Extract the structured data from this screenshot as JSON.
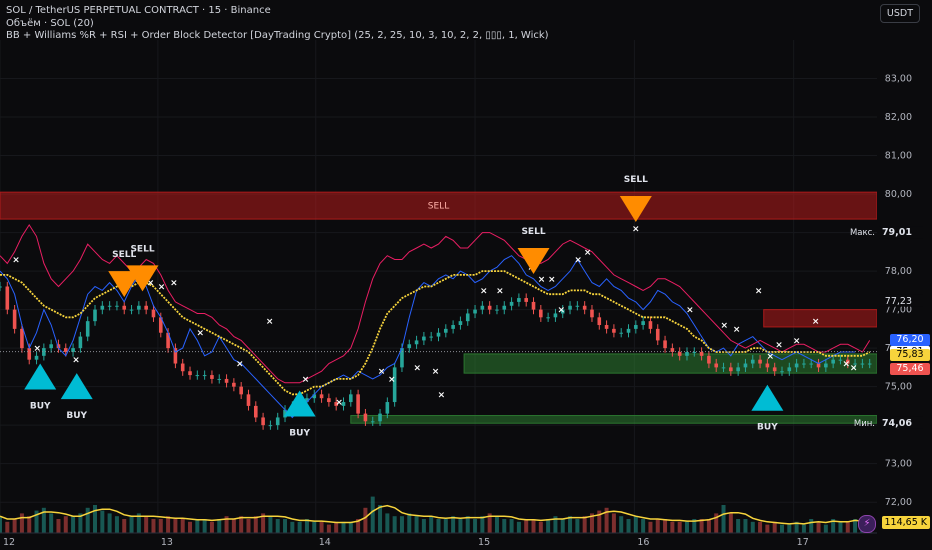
{
  "header": {
    "title": "SOL / TetherUS PERPETUAL CONTRACT · 15 · Binance",
    "volume_label": "Объём · SOL (20)",
    "indicator": "BB + Williams %R + RSI + Order Block Detector [DayTrading Crypto] (25, 2, 25, 10, 3, 10, 2, 2, ▯▯▯, 1, Wick)"
  },
  "currency_button": "USDT",
  "colors": {
    "up": "#26a69a",
    "down": "#ef5350",
    "bb_upper": "#2962ff",
    "bb_lower": "#e91e63",
    "basis": "#f7d43c",
    "buy": "#00bcd4",
    "sell": "#ff8c00",
    "supply_zone": "#b71c1c",
    "demand_zone": "#2e7d32"
  },
  "chart_data": {
    "type": "line",
    "title": "SOL / TetherUS PERPETUAL CONTRACT · 15 · Binance",
    "y_ticks": [
      "83,00",
      "82,00",
      "81,00",
      "80,00",
      "79,01",
      "78,00",
      "77,23",
      "77,00",
      "76,20",
      "75,91",
      "75,83",
      "75,46",
      "75,00",
      "74,06",
      "73,00",
      "72,00"
    ],
    "y_ticks_plain": [
      83,
      82,
      81,
      80,
      79,
      78,
      77,
      76,
      75,
      74,
      73,
      72
    ],
    "x_labels": [
      "12",
      "13",
      "14",
      "15",
      "16",
      "17"
    ],
    "ylim": [
      71.2,
      84.0
    ],
    "x_range": [
      0,
      120
    ],
    "x_label_positions": [
      0,
      21.6,
      43.2,
      65,
      86.8,
      108.6
    ],
    "price_labels": [
      {
        "label": "76,20",
        "value": 76.2,
        "bg": "#2962ff",
        "fg": "#ffffff"
      },
      {
        "label": "75,91",
        "value": 75.91,
        "bg": "#ffffff",
        "fg": "#000000"
      },
      {
        "label": "75,83",
        "value": 75.83,
        "bg": "#f7d43c",
        "fg": "#000000"
      },
      {
        "label": "75,46",
        "value": 75.46,
        "bg": "#ef5350",
        "fg": "#ffffff"
      }
    ],
    "max_label": "Макс.",
    "max_value": 79.01,
    "max_text": "79,01",
    "min_label": "Мин.",
    "min_value": 74.06,
    "min_text": "74,06",
    "current_price_line": 75.91,
    "volume_value": "114,65 K",
    "series": [
      {
        "values": [
          78.0,
          77.8,
          77.4,
          76.6,
          76.0,
          76.4,
          77.0,
          76.6,
          76.0,
          75.8,
          76.2,
          76.8,
          77.4,
          77.6,
          77.5,
          77.7,
          77.5,
          77.2,
          77.6,
          77.9,
          77.6,
          77.1,
          76.8,
          76.4,
          75.9,
          76.0,
          76.5,
          76.2,
          75.8,
          75.9,
          76.3,
          76.0,
          75.7,
          75.6,
          75.4,
          75.2,
          75.0,
          74.8,
          74.6,
          74.4,
          74.2,
          74.4,
          74.6,
          74.8,
          75.0,
          75.1,
          75.2,
          75.3,
          75.2,
          75.4,
          75.3,
          75.2,
          75.3,
          75.5,
          75.6,
          76.0,
          76.8,
          77.5,
          77.7,
          77.6,
          77.8,
          77.9,
          77.8,
          78.0,
          77.9,
          77.7,
          77.8,
          78.0,
          78.1,
          78.3,
          78.4,
          78.2,
          77.9,
          77.8,
          77.6,
          77.5,
          77.6,
          77.8,
          78.0,
          78.3,
          78.0,
          77.7,
          77.6,
          77.8,
          77.6,
          77.5,
          77.3,
          77.2,
          77.0,
          77.2,
          77.5,
          77.4,
          77.2,
          77.1,
          76.9,
          76.6,
          76.3,
          76.0,
          75.9,
          76.0,
          75.8,
          76.1,
          76.2,
          76.3,
          76.1,
          75.9,
          75.8,
          75.7,
          75.8,
          75.9,
          75.8,
          75.7,
          75.6,
          75.7,
          75.8,
          75.9,
          75.9,
          75.9
        ]
      },
      {
        "values": [
          78.4,
          78.2,
          78.5,
          78.9,
          79.2,
          78.9,
          78.2,
          77.8,
          77.6,
          77.8,
          78.0,
          78.3,
          78.7,
          78.5,
          78.3,
          78.2,
          78.4,
          78.2,
          78.0,
          78.1,
          78.3,
          78.2,
          77.9,
          77.5,
          77.2,
          77.1,
          77.0,
          76.9,
          76.9,
          76.8,
          76.6,
          76.5,
          76.3,
          76.2,
          76.0,
          75.8,
          75.6,
          75.4,
          75.2,
          75.1,
          75.1,
          75.1,
          75.2,
          75.3,
          75.4,
          75.6,
          75.7,
          75.8,
          76.0,
          76.5,
          77.2,
          77.8,
          78.2,
          78.4,
          78.3,
          78.3,
          78.5,
          78.6,
          78.7,
          78.6,
          78.7,
          78.9,
          78.8,
          78.6,
          78.6,
          78.8,
          79.0,
          79.0,
          78.9,
          78.8,
          78.6,
          78.4,
          78.3,
          78.3,
          78.2,
          78.3,
          78.5,
          78.7,
          78.8,
          78.7,
          78.6,
          78.5,
          78.3,
          78.1,
          77.9,
          77.8,
          77.7,
          77.6,
          77.5,
          77.6,
          77.8,
          77.8,
          77.7,
          77.6,
          77.4,
          77.2,
          77.0,
          76.8,
          76.6,
          76.4,
          76.2,
          76.1,
          76.0,
          76.1,
          76.2,
          76.1,
          76.0,
          75.9,
          76.0,
          76.1,
          76.1,
          76.0,
          75.9,
          75.9,
          76.0,
          76.1,
          76.1,
          76.0,
          75.9,
          76.2
        ]
      },
      {
        "values": [
          77.9,
          77.9,
          77.8,
          77.7,
          77.5,
          77.3,
          77.1,
          77.0,
          76.9,
          76.8,
          76.8,
          76.9,
          77.1,
          77.3,
          77.4,
          77.5,
          77.6,
          77.6,
          77.6,
          77.7,
          77.7,
          77.6,
          77.4,
          77.2,
          77.0,
          76.8,
          76.7,
          76.6,
          76.5,
          76.4,
          76.3,
          76.2,
          76.1,
          76.0,
          75.9,
          75.7,
          75.5,
          75.3,
          75.1,
          74.9,
          74.8,
          74.8,
          74.9,
          75.0,
          75.0,
          75.1,
          75.2,
          75.2,
          75.2,
          75.3,
          75.6,
          76.0,
          76.5,
          76.9,
          77.1,
          77.3,
          77.4,
          77.5,
          77.6,
          77.6,
          77.7,
          77.8,
          77.9,
          77.9,
          77.9,
          77.9,
          78.0,
          78.0,
          78.0,
          78.0,
          77.9,
          77.8,
          77.7,
          77.6,
          77.5,
          77.4,
          77.4,
          77.4,
          77.5,
          77.5,
          77.5,
          77.4,
          77.4,
          77.3,
          77.2,
          77.1,
          77.0,
          76.9,
          76.8,
          76.8,
          76.8,
          76.8,
          76.7,
          76.6,
          76.5,
          76.3,
          76.2,
          76.0,
          75.9,
          75.9,
          75.9,
          75.9,
          75.9,
          76.0,
          76.0,
          75.9,
          75.9,
          75.9,
          75.9,
          75.9,
          75.9,
          75.9,
          75.9,
          75.8,
          75.8,
          75.8,
          75.8,
          75.8,
          75.8,
          75.9
        ]
      },
      {
        "values": [
          77.6,
          77.0,
          76.5,
          76.0,
          75.7,
          75.8,
          76.0,
          76.1,
          76.0,
          75.9,
          76.0,
          76.3,
          76.7,
          77.0,
          77.1,
          77.1,
          77.1,
          77.0,
          77.0,
          77.1,
          77.0,
          76.8,
          76.4,
          76.0,
          75.6,
          75.4,
          75.3,
          75.3,
          75.3,
          75.2,
          75.2,
          75.1,
          75.0,
          74.8,
          74.5,
          74.2,
          74.0,
          74.0,
          74.2,
          74.4,
          74.5,
          74.6,
          74.7,
          74.8,
          74.7,
          74.6,
          74.5,
          74.6,
          74.8,
          74.3,
          74.1,
          74.1,
          74.3,
          74.6,
          75.5,
          76.0,
          76.1,
          76.2,
          76.3,
          76.3,
          76.4,
          76.5,
          76.6,
          76.7,
          76.9,
          77.0,
          77.1,
          77.0,
          77.0,
          77.1,
          77.2,
          77.3,
          77.2,
          77.0,
          76.8,
          76.8,
          76.9,
          77.0,
          77.1,
          77.1,
          77.0,
          76.8,
          76.6,
          76.5,
          76.4,
          76.4,
          76.5,
          76.6,
          76.7,
          76.5,
          76.2,
          76.0,
          75.9,
          75.8,
          75.9,
          75.9,
          75.8,
          75.6,
          75.5,
          75.5,
          75.4,
          75.5,
          75.6,
          75.7,
          75.6,
          75.5,
          75.4,
          75.4,
          75.5,
          75.6,
          75.6,
          75.6,
          75.5,
          75.6,
          75.7,
          75.7,
          75.6,
          75.6,
          75.6,
          75.6
        ]
      },
      {
        "values": [
          0.6,
          0.4,
          0.5,
          0.7,
          0.6,
          0.8,
          0.9,
          0.7,
          0.5,
          0.6,
          0.6,
          0.7,
          0.9,
          1.0,
          0.8,
          0.7,
          0.6,
          0.5,
          0.6,
          0.7,
          0.6,
          0.5,
          0.5,
          0.6,
          0.5,
          0.5,
          0.4,
          0.5,
          0.5,
          0.4,
          0.5,
          0.6,
          0.5,
          0.6,
          0.5,
          0.6,
          0.7,
          0.6,
          0.5,
          0.5,
          0.4,
          0.4,
          0.5,
          0.4,
          0.4,
          0.3,
          0.4,
          0.4,
          0.4,
          0.5,
          0.9,
          1.3,
          1.0,
          0.7,
          0.6,
          0.6,
          0.7,
          0.6,
          0.5,
          0.6,
          0.5,
          0.5,
          0.6,
          0.5,
          0.6,
          0.5,
          0.6,
          0.7,
          0.6,
          0.5,
          0.5,
          0.4,
          0.5,
          0.5,
          0.4,
          0.5,
          0.6,
          0.5,
          0.6,
          0.5,
          0.6,
          0.7,
          0.8,
          0.9,
          0.7,
          0.6,
          0.5,
          0.6,
          0.5,
          0.4,
          0.5,
          0.5,
          0.4,
          0.4,
          0.4,
          0.5,
          0.5,
          0.5,
          0.7,
          1.0,
          0.7,
          0.5,
          0.5,
          0.4,
          0.4,
          0.3,
          0.4,
          0.3,
          0.3,
          0.4,
          0.3,
          0.5,
          0.4,
          0.3,
          0.5,
          0.4,
          0.4,
          0.5,
          0.4,
          0.3
        ]
      }
    ],
    "zones": [
      {
        "label": "SELL",
        "kind": "supply",
        "x0": 0,
        "x1": 120,
        "y0": 79.35,
        "y1": 80.05
      },
      {
        "label": "",
        "kind": "supply",
        "x0": 104.5,
        "x1": 120,
        "y0": 76.55,
        "y1": 77.0
      },
      {
        "label": "",
        "kind": "demand",
        "x0": 63.5,
        "x1": 120,
        "y0": 75.35,
        "y1": 75.85
      },
      {
        "label": "",
        "kind": "demand",
        "x0": 48,
        "x1": 120,
        "y0": 74.05,
        "y1": 74.25
      }
    ],
    "signals": [
      {
        "type": "BUY",
        "x": 5.5,
        "y": 75.6
      },
      {
        "type": "BUY",
        "x": 10.5,
        "y": 75.35
      },
      {
        "type": "BUY",
        "x": 41,
        "y": 74.9
      },
      {
        "type": "BUY",
        "x": 105,
        "y": 75.05
      },
      {
        "type": "SELL",
        "x": 17,
        "y": 78.0
      },
      {
        "type": "SELL",
        "x": 19.5,
        "y": 78.15
      },
      {
        "type": "SELL",
        "x": 73,
        "y": 78.6
      },
      {
        "type": "SELL",
        "x": 87,
        "y": 79.95
      }
    ],
    "x_marks": [
      {
        "x": 2.2,
        "y": 78.3
      },
      {
        "x": 5.1,
        "y": 76.0
      },
      {
        "x": 10.4,
        "y": 75.7
      },
      {
        "x": 17.3,
        "y": 77.6
      },
      {
        "x": 18.9,
        "y": 77.8
      },
      {
        "x": 20.6,
        "y": 77.7
      },
      {
        "x": 22.1,
        "y": 77.6
      },
      {
        "x": 23.8,
        "y": 77.7
      },
      {
        "x": 27.4,
        "y": 76.4
      },
      {
        "x": 32.8,
        "y": 75.6
      },
      {
        "x": 36.9,
        "y": 76.7
      },
      {
        "x": 41.8,
        "y": 75.2
      },
      {
        "x": 46.4,
        "y": 74.6
      },
      {
        "x": 52.2,
        "y": 75.4
      },
      {
        "x": 53.6,
        "y": 75.2
      },
      {
        "x": 57.1,
        "y": 75.5
      },
      {
        "x": 59.6,
        "y": 75.4
      },
      {
        "x": 60.4,
        "y": 74.8
      },
      {
        "x": 66.2,
        "y": 77.5
      },
      {
        "x": 68.4,
        "y": 77.5
      },
      {
        "x": 72.7,
        "y": 78.1
      },
      {
        "x": 74.1,
        "y": 77.8
      },
      {
        "x": 75.5,
        "y": 77.8
      },
      {
        "x": 76.8,
        "y": 77.0
      },
      {
        "x": 79.1,
        "y": 78.3
      },
      {
        "x": 80.4,
        "y": 78.5
      },
      {
        "x": 87.0,
        "y": 79.1
      },
      {
        "x": 94.4,
        "y": 77.0
      },
      {
        "x": 99.1,
        "y": 76.6
      },
      {
        "x": 100.8,
        "y": 76.5
      },
      {
        "x": 103.8,
        "y": 77.5
      },
      {
        "x": 105.4,
        "y": 75.8
      },
      {
        "x": 106.6,
        "y": 76.1
      },
      {
        "x": 109.0,
        "y": 76.2
      },
      {
        "x": 111.6,
        "y": 76.7
      },
      {
        "x": 115.8,
        "y": 75.6
      },
      {
        "x": 116.8,
        "y": 75.5
      }
    ]
  }
}
